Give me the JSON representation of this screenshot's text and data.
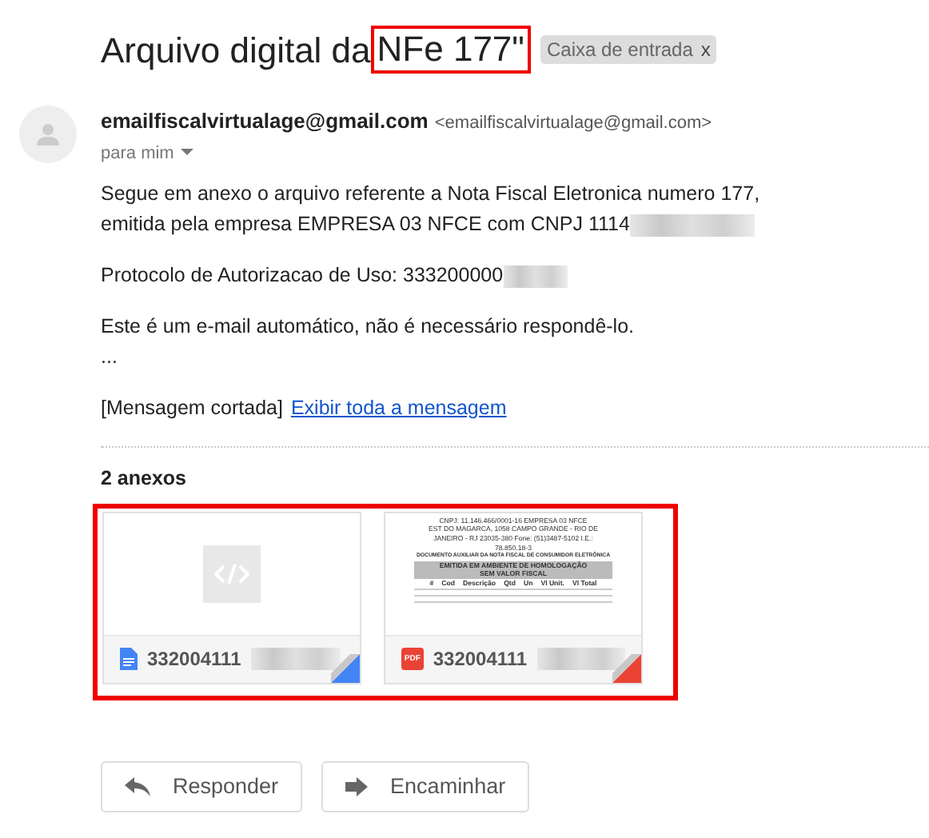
{
  "subject": {
    "text": "Arquivo digital da ",
    "highlighted": "NFe 177\""
  },
  "label": {
    "text": "Caixa de entrada",
    "close": "x"
  },
  "sender": {
    "name": "emailfiscalvirtualage@gmail.com",
    "address": "<emailfiscalvirtualage@gmail.com>",
    "to": "para mim"
  },
  "body": [
    {
      "kind": "text",
      "lines": [
        "Segue em anexo o arquivo referente a Nota Fiscal Eletronica numero 177,",
        "emitida pela empresa EMPRESA 03 NFCE com CNPJ 1114"
      ],
      "redacted": true
    },
    {
      "kind": "text",
      "lines": [
        "Protocolo de Autorizacao de Uso: 333200000"
      ],
      "redacted": true
    },
    {
      "kind": "text",
      "lines": [
        "Este é um e-mail automático, não é necessário respondê-lo.",
        "..."
      ],
      "redacted": false
    }
  ],
  "clipped": {
    "note": "[Mensagem cortada]",
    "link": "Exibir toda a mensagem"
  },
  "attachments": {
    "title": "2 anexos",
    "items": [
      {
        "kind": "code",
        "name": "332004111",
        "color": "#4285f4"
      },
      {
        "kind": "pdf",
        "name": "332004111",
        "color": "#ea4335",
        "icon_text": "PDF",
        "preview": [
          "CNPJ: 11.146.466/0001-16 EMPRESA 03 NFCE",
          "EST DO MAGARCA, 1058 CAMPO GRANDE - RIO DE",
          "JANEIRO - RJ 23035-380 Fone: (51)3487-5102 I.E.:",
          "78.850.18-3",
          "DOCUMENTO AUXILIAR DA NOTA FISCAL DE CONSUMIDOR ELETRÔNICA"
        ],
        "banner": [
          "EMITIDA EM AMBIENTE DE HOMOLOGAÇÃO",
          "SEM VALOR FISCAL"
        ],
        "columns": [
          "#",
          "Cod",
          "Descrição",
          "Qtd",
          "Un",
          "Vl Unit.",
          "Vl Total"
        ]
      }
    ]
  },
  "actions": [
    {
      "kind": "reply",
      "label": "Responder"
    },
    {
      "kind": "forward",
      "label": "Encaminhar"
    }
  ]
}
